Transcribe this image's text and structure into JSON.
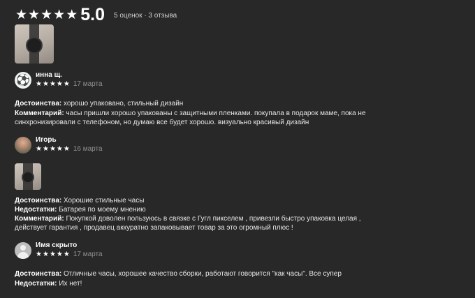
{
  "summary": {
    "stars": [
      "★",
      "★",
      "★",
      "★",
      "★"
    ],
    "score": "5.0",
    "count": "5 оценок · 3 отзыва"
  },
  "reviews": [
    {
      "author": "инна щ.",
      "stars": [
        "★",
        "★",
        "★",
        "★",
        "★"
      ],
      "date": "17 марта",
      "pros_label": "Достоинства:",
      "pros": "хорошо упаковано, стильный дизайн",
      "comment_label": "Комментарий:",
      "comment_line1": "часы пришли хорошо упакованы с защитными пленками. покупала в подарок маме, пока не",
      "comment_line2": "синхронизировали с телефоном, но думаю все будет хорошо. визуально красивый дизайн"
    },
    {
      "author": "Игорь",
      "stars": [
        "★",
        "★",
        "★",
        "★",
        "★"
      ],
      "date": "16 марта",
      "pros_label": "Достоинства:",
      "pros": "Хорошие стильные часы",
      "cons_label": "Недостатки:",
      "cons": "Батарея по моему мнению",
      "comment_label": "Комментарий:",
      "comment_line1": "Покупкой доволен пользуюсь в связке с Гугл пикселем , привезли быстро упаковка целая ,",
      "comment_line2": "действует гарантия , продавец аккуратно запаковывает товар за это огромный плюс !"
    },
    {
      "author": "Имя скрыто",
      "stars": [
        "★",
        "★",
        "★",
        "★",
        "★"
      ],
      "date": "17 марта",
      "pros_label": "Достоинства:",
      "pros": "Отличные часы, хорошее качество сборки, работают говорится \"как часы\". Все супер",
      "cons_label": "Недостатки:",
      "cons": "Их нет!"
    }
  ]
}
